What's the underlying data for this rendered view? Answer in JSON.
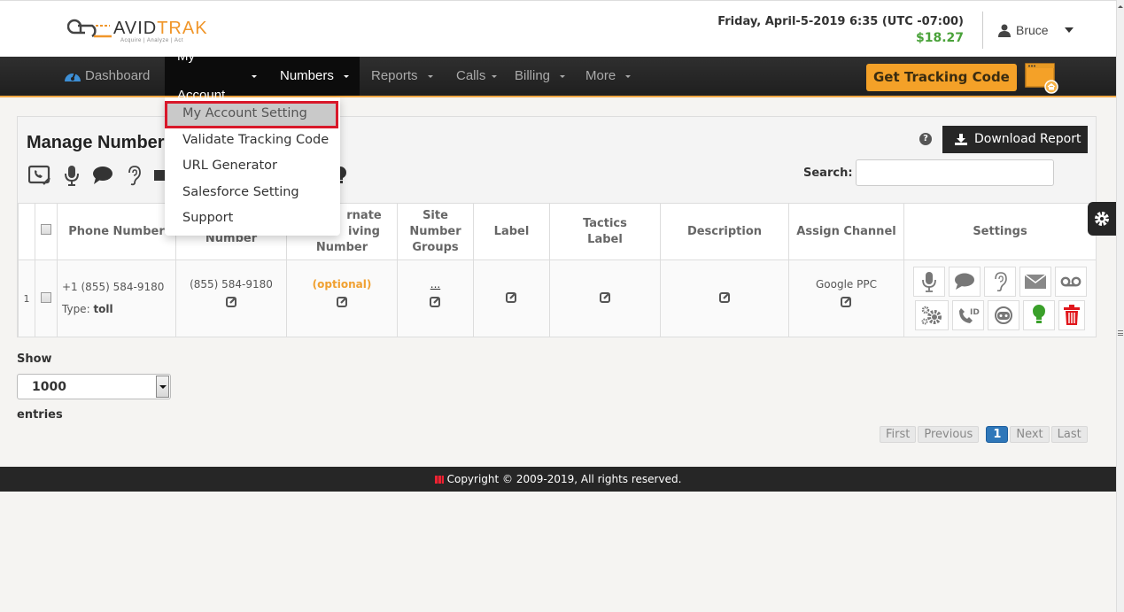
{
  "header": {
    "logo": {
      "brand_a": "AVID",
      "brand_b": "TRAK",
      "tagline": "Acquire | Analyze | Act"
    },
    "datetime": "Friday, April-5-2019 6:35 (UTC -07:00)",
    "balance": "$18.27",
    "user": "Bruce"
  },
  "nav": {
    "items": [
      {
        "label": "Dashboard",
        "icon": "dashboard-gauge-icon"
      },
      {
        "label": "My Account",
        "dropdown": true,
        "active": true
      },
      {
        "label": "Numbers",
        "dropdown": true,
        "active": true
      },
      {
        "label": "Reports",
        "dropdown": true
      },
      {
        "label": "Calls",
        "dropdown": true
      },
      {
        "label": "Billing",
        "dropdown": true
      },
      {
        "label": "More",
        "dropdown": true
      }
    ],
    "get_tracking_code": "Get Tracking Code"
  },
  "account_menu": {
    "items": [
      {
        "label": "My Account Setting",
        "highlighted": true
      },
      {
        "label": "Validate Tracking Code"
      },
      {
        "label": "URL Generator"
      },
      {
        "label": "Salesforce Setting"
      },
      {
        "label": "Support"
      }
    ]
  },
  "panel": {
    "title": "Manage Numbers",
    "download_label": "Download Report",
    "search_label": "Search:",
    "search_value": "",
    "toolbar_icons": [
      "call-edit-icon",
      "microphone-icon",
      "chat-icon",
      "ear-icon",
      "envelope-icon",
      "lightbulb-icon"
    ]
  },
  "table": {
    "columns": [
      "",
      "",
      "Phone Number",
      "Forwarding Number",
      "Alternate Receiving Number",
      "Site Number Groups",
      "Label",
      "Tactics Label",
      "Description",
      "Assign Channel",
      "Settings"
    ],
    "column_visible": {
      "forwarding": "Number",
      "alternate_1": "rnate",
      "alternate_2": "iving",
      "alternate_3": "Number",
      "site_1": "Site",
      "site_2": "Number",
      "site_3": "Groups",
      "tactics_1": "Tactics",
      "tactics_2": "Label"
    },
    "rows": [
      {
        "index": "1",
        "phone": "+1 (855) 584-9180",
        "type_label": "Type:",
        "type": "toll",
        "forwarding": "(855) 584-9180",
        "alternate": "(optional)",
        "site_groups": "...",
        "label": "",
        "tactics_label": "",
        "description": "",
        "channel": "Google PPC",
        "settings_icons": [
          "microphone-icon",
          "chat-icon",
          "ear-icon",
          "envelope-icon",
          "voicemail-icon",
          "gears-icon",
          "caller-id-icon",
          "headset-icon",
          "lightbulb-icon",
          "trash-icon"
        ]
      }
    ]
  },
  "length": {
    "show_label": "Show",
    "value": "1000",
    "entries_label": "entries"
  },
  "pagination": {
    "first": "First",
    "previous": "Previous",
    "current": "1",
    "next": "Next",
    "last": "Last"
  },
  "footer": {
    "copyright": "Copyright © 2009-2019, All rights reserved."
  },
  "colors": {
    "accent": "#f4a128",
    "balance": "#4aa23a",
    "highlight_border": "#d9182a",
    "page_active": "#2f77b9",
    "delete": "#e0161c",
    "bulb": "#3aa02a"
  }
}
